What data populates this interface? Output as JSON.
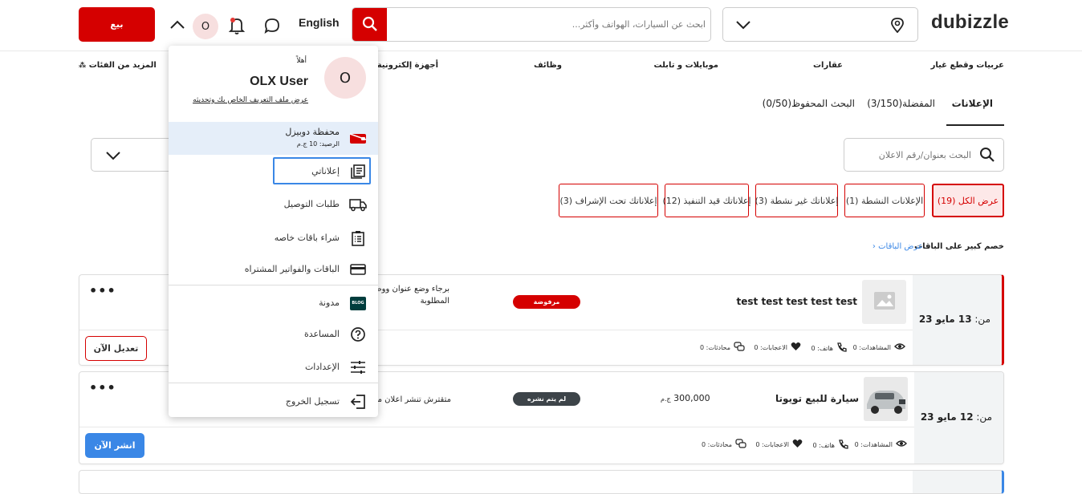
{
  "header": {
    "logo": "dubizzle",
    "sell_label": "بيع",
    "avatar_initial": "O",
    "language": "English",
    "search_placeholder": "ابحث عن السيارات، الهواتف وأكثر..."
  },
  "categories": [
    "عربيات وقطع غيار",
    "عقارات",
    "موبايلات و تابلت",
    "وظائف",
    "أجهزة إلكترونية",
    "المزيد من الفئات"
  ],
  "tabs": {
    "ads": "الإعلانات",
    "favorites": "المفضلة(3/150)",
    "saved_search": "البحث المحفوظ(0/50)"
  },
  "ads_search_placeholder": "البحث بعنوان/رقم الاعلان",
  "filters": [
    "عرض الكل (19)",
    "الإعلانات النشطة (1)",
    "إعلاناتك غير نشطة (3)",
    "إعلاناتك قيد التنفيذ (12)",
    "إعلاناتك تحت الإشراف (3)"
  ],
  "promo": {
    "text": "خصم كبير على الباقات",
    "link": "عرض الباقات"
  },
  "ads": [
    {
      "date_prefix": "من:",
      "date": "13 مايو 23",
      "title": "test test test test test",
      "status": "مرفوضة",
      "message_line1": "برجاء وضع عنوان ووصف",
      "message_line2": "المطلوبة",
      "views": "المشاهدات: 0",
      "calls": "هاتف: 0",
      "likes": "الاعجابات: 0",
      "chats": "محادثات: 0",
      "action": "تعديل الآن"
    },
    {
      "date_prefix": "من:",
      "date": "12 مايو 23",
      "title": "سيارة للبيع تويوتا",
      "price": "300,000",
      "currency": "ج.م",
      "status": "لم يتم نشره",
      "message_line1": "متقترش تنشر اعلان مجا",
      "views": "المشاهدات: 0",
      "calls": "هاتف: 0",
      "likes": "الاعجابات: 0",
      "chats": "محادثات: 0",
      "action": "انشر الآن"
    }
  ],
  "colors": {
    "brand_red": "#d50000",
    "publish_blue": "#3a87e6",
    "badge_rejected": "#d50000",
    "badge_unpublished": "#3d4449"
  },
  "user_menu": {
    "greeting": "أهلاً",
    "name": "OLX User",
    "profile_link": "عرض ملف التعريف الخاص بك وتحديثه",
    "wallet_title": "محفظة دوبيزل",
    "wallet_balance": "الرصيد: 10 ج.م",
    "items": [
      {
        "label": "إعلاناتي",
        "icon": "my-ads-icon"
      },
      {
        "label": "طلبات التوصيل",
        "icon": "truck-icon"
      },
      {
        "label": "شراء باقات خاصه",
        "icon": "checklist-icon"
      },
      {
        "label": "الباقات والفواتير المشتراه",
        "icon": "card-icon"
      },
      {
        "label": "مدونة",
        "icon": "blog-icon",
        "icon_text": "BLOG"
      },
      {
        "label": "المساعدة",
        "icon": "help-icon"
      },
      {
        "label": "الإعدادات",
        "icon": "settings-icon"
      },
      {
        "label": "تسجيل الخروج",
        "icon": "logout-icon"
      }
    ]
  }
}
